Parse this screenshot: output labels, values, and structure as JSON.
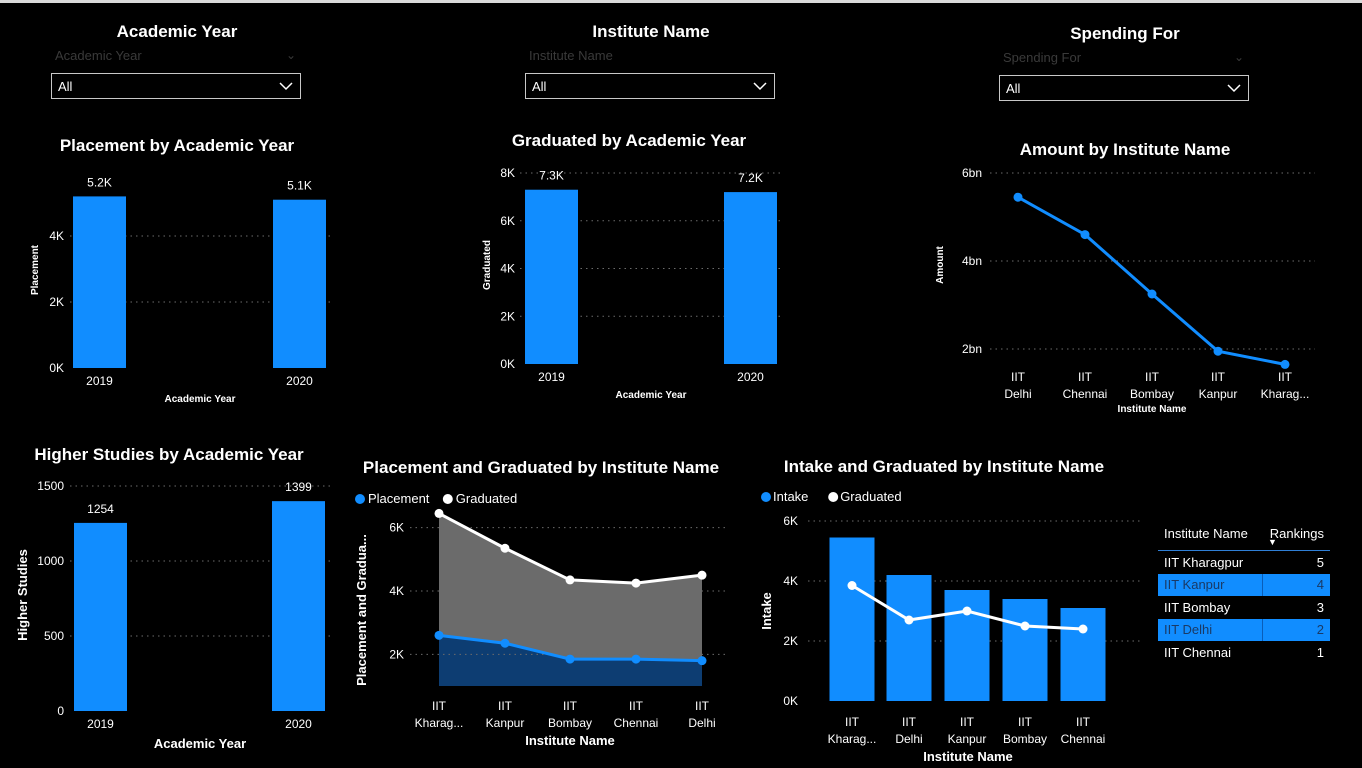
{
  "slicers": [
    {
      "title": "Academic Year",
      "placeholder": "Academic Year",
      "value": "All"
    },
    {
      "title": "Institute Name",
      "placeholder": "Institute Name",
      "value": "All"
    },
    {
      "title": "Spending For",
      "placeholder": "Spending For",
      "value": "All"
    }
  ],
  "chart_data": [
    {
      "id": "placement_by_year",
      "type": "bar",
      "title": "Placement by Academic Year",
      "xlabel": "Academic Year",
      "ylabel": "Placement",
      "categories": [
        "2019",
        "2020"
      ],
      "values": [
        5200,
        5100
      ],
      "data_labels": [
        "5.2K",
        "5.1K"
      ],
      "ylim": [
        0,
        6000
      ],
      "yticks": [
        "0K",
        "2K",
        "4K"
      ],
      "ytick_values": [
        0,
        2000,
        4000
      ],
      "color": "#118dff"
    },
    {
      "id": "graduated_by_year",
      "type": "bar",
      "title": "Graduated by Academic Year",
      "xlabel": "Academic Year",
      "ylabel": "Graduated",
      "categories": [
        "2019",
        "2020"
      ],
      "values": [
        7300,
        7200
      ],
      "data_labels": [
        "7.3K",
        "7.2K"
      ],
      "ylim": [
        0,
        8000
      ],
      "yticks": [
        "0K",
        "2K",
        "4K",
        "6K",
        "8K"
      ],
      "ytick_values": [
        0,
        2000,
        4000,
        6000,
        8000
      ],
      "color": "#118dff"
    },
    {
      "id": "amount_by_institute",
      "type": "line",
      "title": "Amount by Institute Name",
      "xlabel": "Institute Name",
      "ylabel": "Amount",
      "categories": [
        "IIT Delhi",
        "IIT Chennai",
        "IIT Bombay",
        "IIT Kanpur",
        "IIT Kharag..."
      ],
      "values": [
        5.45,
        4.6,
        3.25,
        1.95,
        1.65
      ],
      "ylim": [
        1.0,
        6.0
      ],
      "yticks": [
        "2bn",
        "4bn",
        "6bn"
      ],
      "ytick_values": [
        2,
        4,
        6
      ],
      "color": "#118dff"
    },
    {
      "id": "higher_studies_by_year",
      "type": "bar",
      "title": "Higher Studies by Academic Year",
      "xlabel": "Academic Year",
      "ylabel": "Higher Studies",
      "categories": [
        "2019",
        "2020"
      ],
      "values": [
        1254,
        1399
      ],
      "data_labels": [
        "1254",
        "1399"
      ],
      "ylim": [
        0,
        1500
      ],
      "yticks": [
        "0",
        "500",
        "1000",
        "1500"
      ],
      "ytick_values": [
        0,
        500,
        1000,
        1500
      ],
      "color": "#118dff"
    },
    {
      "id": "placement_graduated_by_institute",
      "type": "area",
      "title": "Placement and Graduated by Institute Name",
      "xlabel": "Institute Name",
      "ylabel": "Placement and Gradua...",
      "categories": [
        "IIT Kharag...",
        "IIT Kanpur",
        "IIT Bombay",
        "IIT Chennai",
        "IIT Delhi"
      ],
      "series": [
        {
          "name": "Placement",
          "values": [
            2600,
            2350,
            1850,
            1850,
            1800
          ],
          "color": "#118dff"
        },
        {
          "name": "Graduated",
          "values": [
            6450,
            5350,
            4350,
            4250,
            4500
          ],
          "color": "#ffffff"
        }
      ],
      "ylim": [
        1000,
        7000
      ],
      "yticks": [
        "2K",
        "4K",
        "6K"
      ],
      "ytick_values": [
        2000,
        4000,
        6000
      ]
    },
    {
      "id": "intake_graduated_by_institute",
      "type": "bar",
      "title": "Intake and Graduated by Institute Name",
      "xlabel": "Institute Name",
      "ylabel": "Intake",
      "categories": [
        "IIT Kharag...",
        "IIT Delhi",
        "IIT Kanpur",
        "IIT Bombay",
        "IIT Chennai"
      ],
      "series": [
        {
          "name": "Intake",
          "values": [
            5450,
            4200,
            3700,
            3400,
            3100
          ],
          "color": "#118dff"
        },
        {
          "name": "Graduated",
          "values": [
            3850,
            2700,
            3000,
            2500,
            2400
          ],
          "color": "#ffffff"
        }
      ],
      "ylim": [
        0,
        6000
      ],
      "yticks": [
        "0K",
        "2K",
        "4K",
        "6K"
      ],
      "ytick_values": [
        0,
        2000,
        4000,
        6000
      ]
    }
  ],
  "rankings_table": {
    "columns": [
      "Institute Name",
      "Rankings"
    ],
    "rows": [
      {
        "name": "IIT Kharagpur",
        "rank": "5",
        "selected": false
      },
      {
        "name": "IIT Kanpur",
        "rank": "4",
        "selected": true
      },
      {
        "name": "IIT Bombay",
        "rank": "3",
        "selected": false
      },
      {
        "name": "IIT Delhi",
        "rank": "2",
        "selected": true
      },
      {
        "name": "IIT Chennai",
        "rank": "1",
        "selected": false
      }
    ]
  }
}
